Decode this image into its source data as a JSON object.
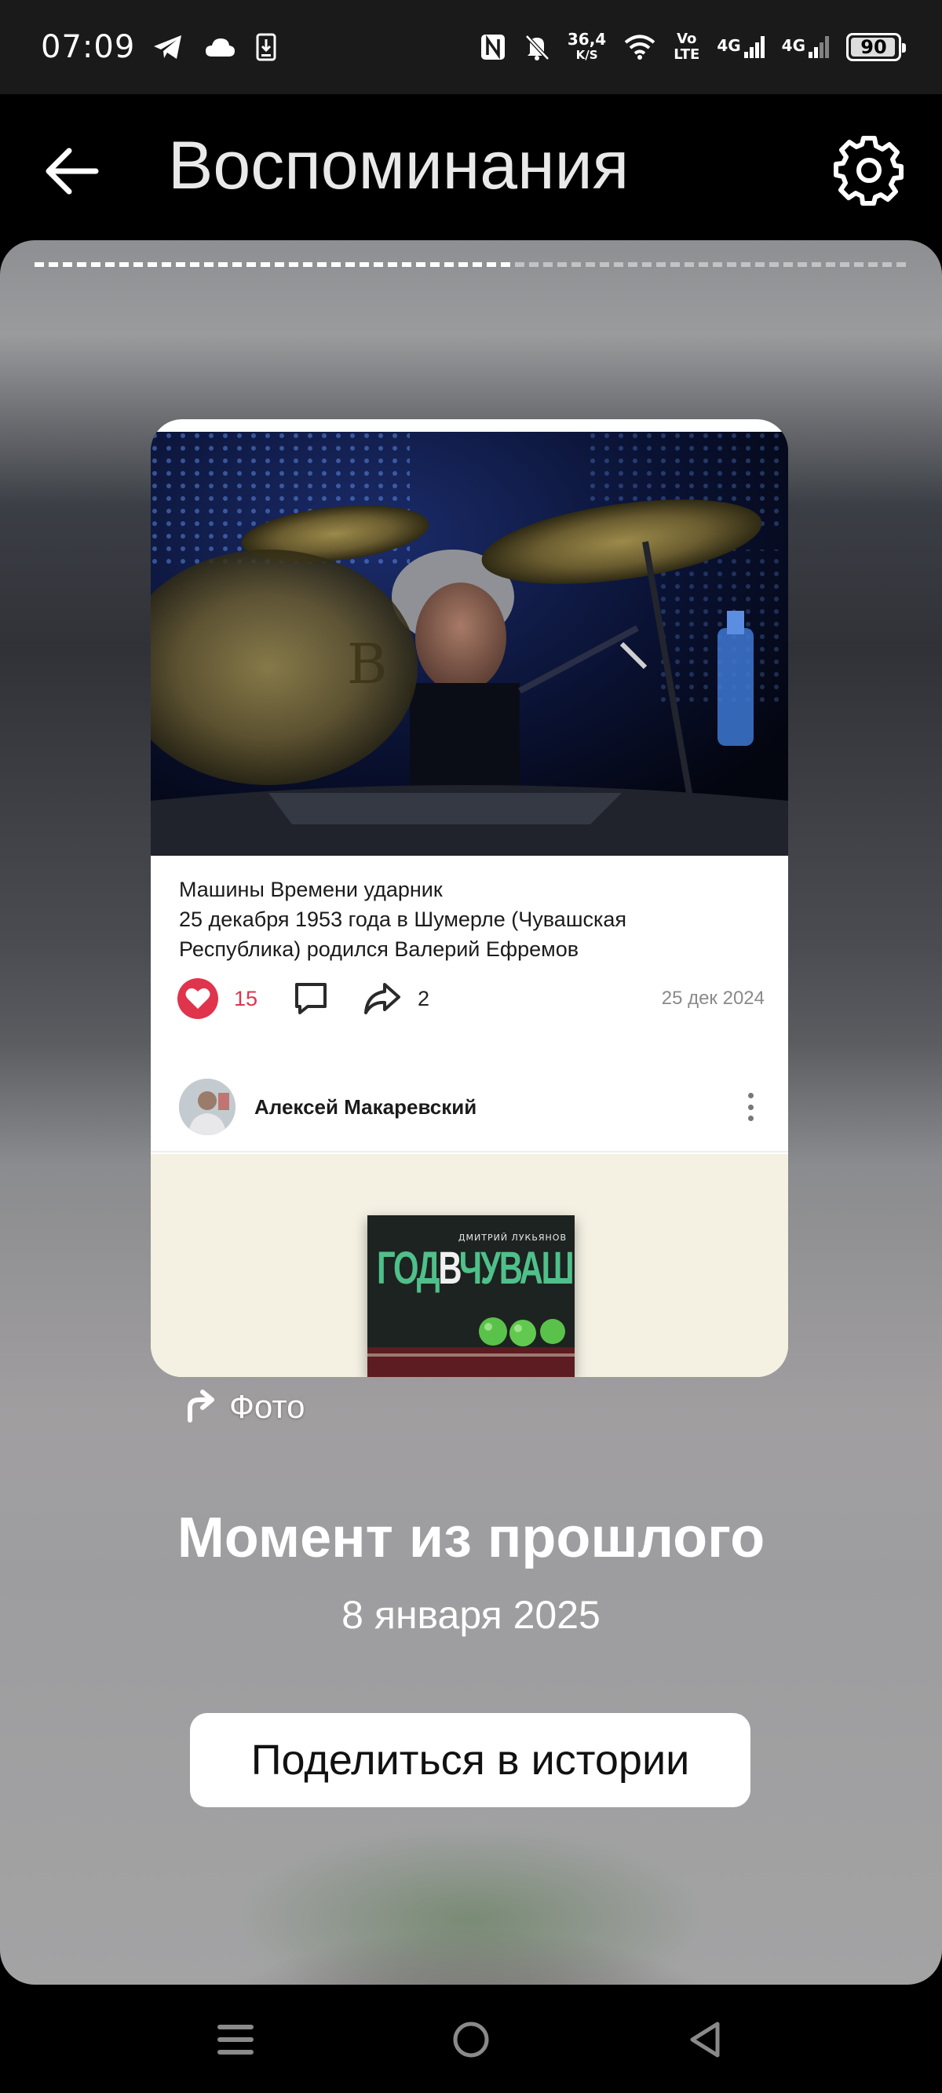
{
  "status_bar": {
    "time": "07:09",
    "net_speed_value": "36,4",
    "net_speed_unit": "K/S",
    "volte_top": "Vo",
    "volte_bottom": "LTE",
    "signal1_label": "4G",
    "signal2_label": "4G",
    "battery": "90"
  },
  "header": {
    "title": "Воспоминания"
  },
  "story": {
    "progress": 0.55,
    "post": {
      "text_lines": [
        "Машины Времени ударник",
        "25 декабря 1953 года в Шумерле (Чувашская",
        "Республика) родился Валерий Ефремов"
      ],
      "likes": "15",
      "shares": "2",
      "date": "25 дек 2024"
    },
    "next_post": {
      "author": "Алексей Макаревский",
      "book_author": "ДМИТРИЙ ЛУКЬЯНОВ",
      "book_title_part1": "ГОД",
      "book_title_part2": "В",
      "book_title_part3": "ЧУВАШИИ"
    },
    "origin_label": "Фото",
    "moment_title": "Момент из прошлого",
    "moment_date": "8 января 2025",
    "share_button": "Поделиться в истории"
  },
  "colors": {
    "like": "#e0344c",
    "status_bar_bg": "#1a1a1a",
    "story_bg": "#9d9d9f"
  },
  "icons": {
    "back": "arrow-left-icon",
    "settings": "gear-icon",
    "like": "heart-icon",
    "comment": "comment-icon",
    "share": "share-icon",
    "repost": "repost-arrow-icon",
    "nav_menu": "menu-icon",
    "nav_home": "home-icon",
    "nav_back": "back-triangle-icon"
  }
}
